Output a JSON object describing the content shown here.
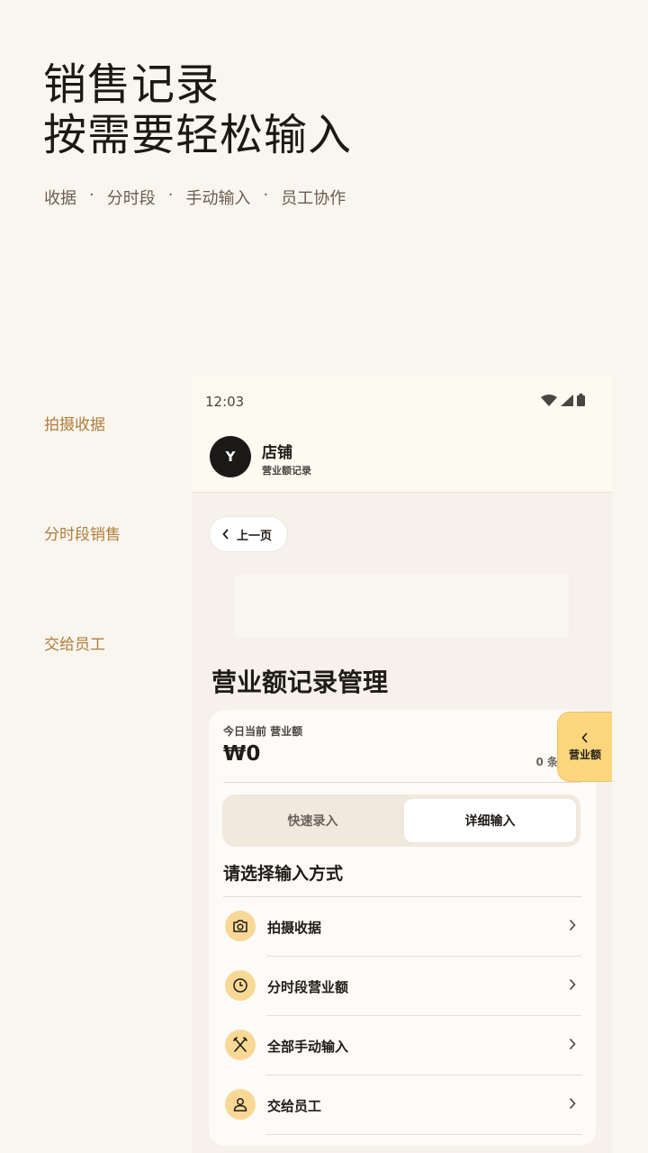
{
  "promo": {
    "title_line1": "销售记录",
    "title_line2": "按需要轻松输入",
    "tags": [
      "收据",
      "分时段",
      "手动输入",
      "员工协作"
    ],
    "tag_separator": "·",
    "side_labels": [
      "拍摄收据",
      "分时段销售",
      "交给员工"
    ]
  },
  "phone": {
    "status": {
      "time": "12:03",
      "icons": [
        "wifi-icon",
        "signal-icon",
        "battery-icon"
      ]
    },
    "header": {
      "avatar_letter": "Y",
      "store_name": "店铺",
      "store_subtitle": "营业额记录"
    },
    "back_label": "上一页",
    "page_title": "营业额记录管理",
    "today": {
      "label": "今日当前 营业额",
      "amount": "₩0",
      "count": "0 条"
    },
    "segments": {
      "quick": "快速录入",
      "detail": "详细输入",
      "selected": "detail"
    },
    "method_title": "请选择输入方式",
    "methods": [
      {
        "label": "拍摄收据",
        "icon": "camera-icon"
      },
      {
        "label": "分时段营业额",
        "icon": "clock-icon"
      },
      {
        "label": "全部手动输入",
        "icon": "utensils-icon"
      },
      {
        "label": "交给员工",
        "icon": "person-icon"
      }
    ],
    "fab_label": "营业额"
  },
  "colors": {
    "background": "#f9f6f0",
    "accent_text": "#b07d3a",
    "icon_circle": "#f9d896",
    "fab": "#fcd67d"
  }
}
